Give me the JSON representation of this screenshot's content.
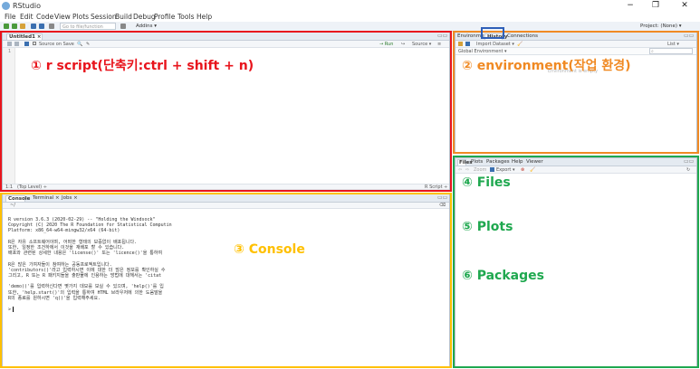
{
  "window": {
    "title": "RStudio",
    "minimize": "−",
    "maximize": "❐",
    "close": "✕"
  },
  "menu": [
    "File",
    "Edit",
    "Code",
    "View",
    "Plots",
    "Session",
    "Build",
    "Debug",
    "Profile",
    "Tools",
    "Help"
  ],
  "toolbar": {
    "goto_placeholder": "Go to file/function",
    "addins_label": "Addins ▾",
    "project_label": "Project: (None) ▾"
  },
  "source_pane": {
    "tab_label": "Untitled1 ×",
    "source_on_save": "Source on Save",
    "run_label": "→ Run",
    "source_label": "Source ▾",
    "line_number": "1",
    "status_left": "1:1",
    "status_center": "(Top Level) ÷",
    "status_right": "R Script ÷"
  },
  "env_pane": {
    "tabs": [
      "Environment",
      "History",
      "Connections"
    ],
    "import_label": "Import Dataset ▾",
    "list_label": "List ▾",
    "global_env_label": "Global Environment ▾",
    "empty_message": "Environment is empty"
  },
  "files_pane": {
    "tabs": [
      "Files",
      "Plots",
      "Packages",
      "Help",
      "Viewer"
    ],
    "zoom_label": "Zoom",
    "export_label": "Export ▾"
  },
  "console_pane": {
    "tabs": [
      "Console",
      "Terminal ×",
      "Jobs ×"
    ],
    "path_label": "~/",
    "lines": [
      "R version 3.6.3 (2020-02-29) -- \"Holding the Windsock\"",
      "Copyright (C) 2020 The R Foundation for Statistical Computin",
      "Platform: x86_64-w64-mingw32/x64 (64-bit)",
      "",
      "R은 자유 소프트웨어이며, 어떠한 형태의 보증없이 배포됩니다.",
      "또한, 일정한 조건하에서 이것을 재배포 할 수 있습니다.",
      "배포와 관련된 상세한 내용은 'license()' 또는 'licence()'을 통하여",
      "",
      "R은 많은 기여자들이 참여하는 공동프로젝트입니다.",
      "'contributors()'라고 입력하시면 이에 대한 더 많은 정보를 확인하실 수",
      "그리고, R 또는 R 패키지들을 출판물에 인용하는 방법에 대해서는 'citat",
      "",
      "'demo()'를 입력하신다면 몇가지 데모를 보실 수 있으며, 'help()'를 입",
      "또한, 'help.start()'의 입력을 통하여 HTML 브라우저에 의한 도움말을",
      "R의 종료를 원하시면 'q()'을 입력해주세요.",
      "",
      ">"
    ]
  },
  "annotations": {
    "script": "① r script(단축키:ctrl + shift + n)",
    "environment": "② environment(작업 환경)",
    "console": "③ Console",
    "files": "④ Files",
    "plots": "⑤ Plots",
    "packages": "⑥ Packages"
  },
  "colors": {
    "red": "#e8141c",
    "orange": "#f08a24",
    "yellow": "#ffc000",
    "green": "#1fa84f",
    "blue": "#2e5fb8"
  }
}
